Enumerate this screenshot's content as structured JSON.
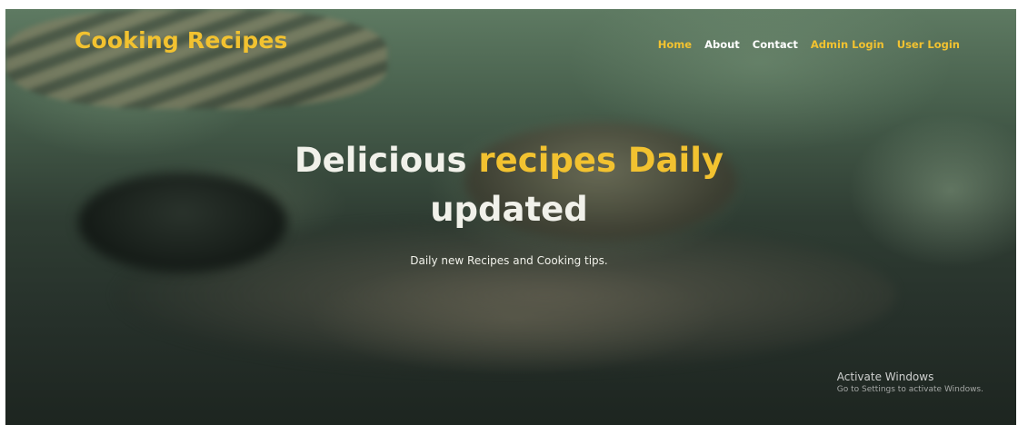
{
  "header": {
    "brand": "Cooking Recipes",
    "nav": [
      {
        "label": "Home"
      },
      {
        "label": "About"
      },
      {
        "label": "Contact"
      },
      {
        "label": "Admin Login"
      },
      {
        "label": "User Login"
      }
    ]
  },
  "hero": {
    "headline_part1": "Delicious ",
    "headline_accent": "recipes Daily",
    "headline_part2": "updated",
    "subtitle": "Daily new Recipes and Cooking tips."
  },
  "watermark": {
    "title": "Activate Windows",
    "subtitle": "Go to Settings to activate Windows."
  },
  "colors": {
    "accent": "#f2c230",
    "text": "#f1f1ea"
  }
}
